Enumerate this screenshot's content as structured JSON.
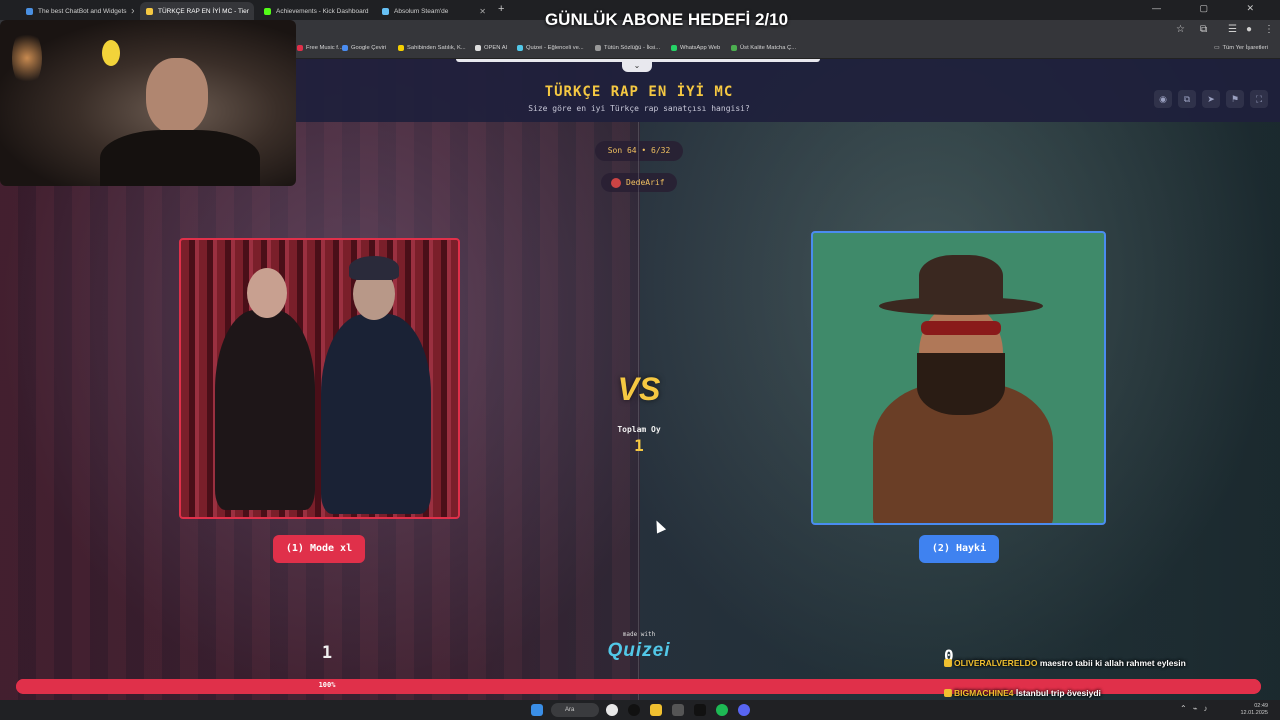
{
  "browser": {
    "tabs": [
      {
        "label": "The best ChatBot and Widgets",
        "active": false,
        "color": "#4a90e2"
      },
      {
        "label": "TÜRKÇE RAP EN İYİ MC - Tier",
        "active": true,
        "color": "#f5c842"
      },
      {
        "label": "Achievements - Kick Dashboard",
        "active": false,
        "color": "#53fc18"
      },
      {
        "label": "Absolum Steam'de",
        "active": false,
        "color": "#66c0f4"
      }
    ],
    "close_glyph": "✕",
    "new_tab_glyph": "+",
    "bookmarks": [
      {
        "label": "Free Music f...",
        "color": "#e0304a"
      },
      {
        "label": "Google Çeviri",
        "color": "#4a8cf0"
      },
      {
        "label": "Sahibinden Satılık, K...",
        "color": "#f5d000"
      },
      {
        "label": "OPEN AI",
        "color": "#dddddd"
      },
      {
        "label": "Quizei - Eğlenceli ve...",
        "color": "#52c8e8"
      },
      {
        "label": "Tütün Sözlüğü - İksi...",
        "color": "#999999"
      },
      {
        "label": "WhatsApp Web",
        "color": "#25d366"
      },
      {
        "label": "Üst Kalite Matcha Ç...",
        "color": "#4caf50"
      }
    ],
    "all_bookmarks": "Tüm Yer İşaretleri"
  },
  "stream_overlay": {
    "goal_banner": "GÜNLÜK ABONE HEDEFİ 2/10",
    "chat": [
      {
        "user": "OLIVERALVERELDO",
        "message": "maestro tabii ki allah rahmet eylesin"
      },
      {
        "user": "BIGMACHINE4",
        "message": "İstanbul trip övesiydi"
      }
    ],
    "chat_counter": "0"
  },
  "quiz": {
    "title": "TÜRKÇE RAP EN İYİ MC",
    "subtitle": "Size göre en iyi Türkçe rap sanatçısı hangisi?",
    "round": "Son 64 • 6/32",
    "user": "DedeArif",
    "vs": "VS",
    "total_label": "Toplam Oy",
    "total_value": "1",
    "left": {
      "label": "(1) Mode xl",
      "count": "1",
      "accent": "#e0304a"
    },
    "right": {
      "label": "(2) Hayki",
      "count": "0",
      "accent": "#3f82f0"
    },
    "progress": {
      "label": "100%",
      "value": 100
    },
    "made_with": "made with",
    "brand": "Quizei"
  },
  "taskbar": {
    "search_label": "Ara",
    "time": "02:49",
    "date": "12.01.2025"
  },
  "icons": {
    "window_controls": "—  ▢  ✕",
    "header_buttons": [
      "eye-icon",
      "copy-icon",
      "send-icon",
      "flag-icon",
      "fullscreen-icon"
    ]
  }
}
